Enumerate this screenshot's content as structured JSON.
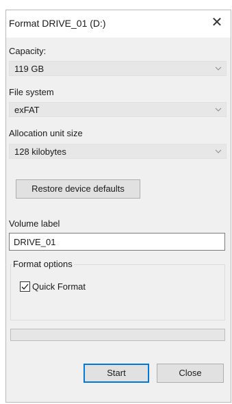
{
  "window": {
    "title": "Format DRIVE_01 (D:)",
    "close_icon": "close-icon"
  },
  "capacity": {
    "label": "Capacity:",
    "value": "119 GB"
  },
  "file_system": {
    "label": "File system",
    "value": "exFAT"
  },
  "allocation": {
    "label": "Allocation unit size",
    "value": "128 kilobytes"
  },
  "restore_button": "Restore device defaults",
  "volume": {
    "label": "Volume label",
    "value": "DRIVE_01"
  },
  "format_options": {
    "label": "Format options",
    "quick_format_label": "Quick Format",
    "quick_format_checked": true
  },
  "progress": {
    "fraction": 0
  },
  "buttons": {
    "start": "Start",
    "close": "Close"
  },
  "colors": {
    "accent": "#0078d7",
    "progress_fill": "#06b025"
  }
}
